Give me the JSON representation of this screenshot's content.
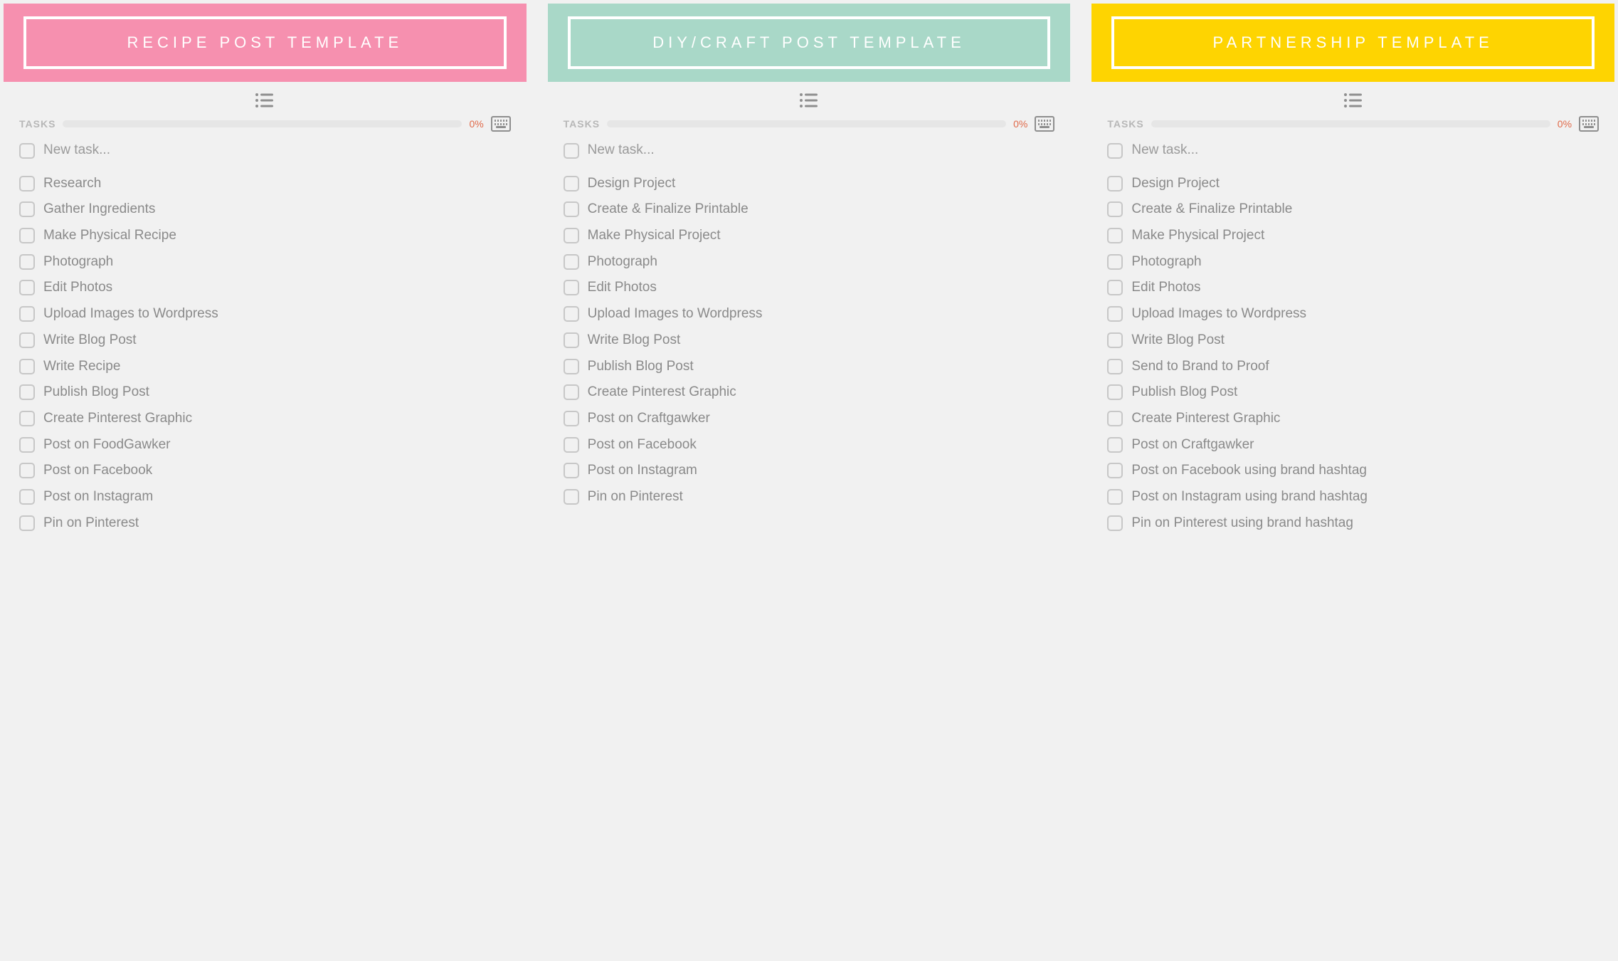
{
  "ui": {
    "tasks_label": "TASKS",
    "new_task_placeholder": "New task...",
    "progress_percent": "0%"
  },
  "columns": [
    {
      "title": "RECIPE POST TEMPLATE",
      "header_bg": "#f690af",
      "tasks": [
        "Research",
        "Gather Ingredients",
        "Make Physical Recipe",
        "Photograph",
        "Edit Photos",
        "Upload Images to Wordpress",
        "Write Blog Post",
        "Write Recipe",
        "Publish Blog Post",
        "Create Pinterest Graphic",
        "Post on FoodGawker",
        "Post on Facebook",
        "Post on Instagram",
        "Pin on Pinterest"
      ]
    },
    {
      "title": "DIY/CRAFT POST TEMPLATE",
      "header_bg": "#a9d8c8",
      "tasks": [
        "Design Project",
        "Create & Finalize Printable",
        "Make Physical Project",
        "Photograph",
        "Edit Photos",
        "Upload Images to Wordpress",
        "Write Blog Post",
        "Publish Blog Post",
        "Create Pinterest Graphic",
        "Post on Craftgawker",
        "Post on Facebook",
        "Post on Instagram",
        " Pin on Pinterest"
      ]
    },
    {
      "title": "PARTNERSHIP TEMPLATE",
      "header_bg": "#fed401",
      "tasks": [
        "Design Project",
        "Create & Finalize Printable",
        "Make Physical Project",
        "Photograph",
        "Edit Photos",
        "Upload Images to Wordpress",
        " Write Blog Post",
        "Send to Brand to Proof",
        "Publish Blog Post",
        "Create Pinterest Graphic",
        "Post on Craftgawker",
        "Post on Facebook using brand hashtag",
        "Post on Instagram using brand hashtag",
        "Pin on Pinterest using brand hashtag"
      ]
    }
  ]
}
